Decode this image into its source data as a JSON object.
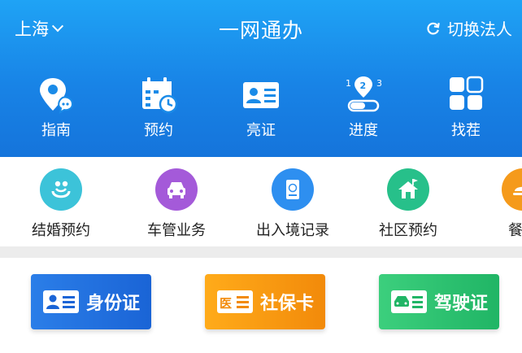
{
  "header": {
    "city": "上海",
    "title": "一网通办",
    "switch_label": "切换法人",
    "quick_items": [
      {
        "label": "指南",
        "icon": "map-pin-chat-icon"
      },
      {
        "label": "预约",
        "icon": "calendar-clock-icon"
      },
      {
        "label": "亮证",
        "icon": "id-card-icon"
      },
      {
        "label": "进度",
        "icon": "progress-steps-icon"
      },
      {
        "label": "找茬",
        "icon": "grid-squares-icon"
      }
    ]
  },
  "services": [
    {
      "label": "结婚预约",
      "icon": "wedding-icon",
      "color": "#3cc3d9"
    },
    {
      "label": "车管业务",
      "icon": "car-icon",
      "color": "#a45ad9"
    },
    {
      "label": "出入境记录",
      "icon": "passport-icon",
      "color": "#2e8ff0"
    },
    {
      "label": "社区预约",
      "icon": "house-flag-icon",
      "color": "#27c08a"
    },
    {
      "label": "餐饮",
      "icon": "food-icon",
      "color": "#f59a1b"
    }
  ],
  "cards": [
    {
      "label": "身份证",
      "icon": "id-card-icon",
      "color_from": "#2b7ee8",
      "color_to": "#1a64d6"
    },
    {
      "label": "社保卡",
      "icon_text": "医",
      "icon": "social-security-card-icon",
      "color_from": "#ffab1a",
      "color_to": "#f28a0a"
    },
    {
      "label": "驾驶证",
      "icon": "driver-license-icon",
      "color_from": "#3ccf7d",
      "color_to": "#20b565"
    }
  ]
}
